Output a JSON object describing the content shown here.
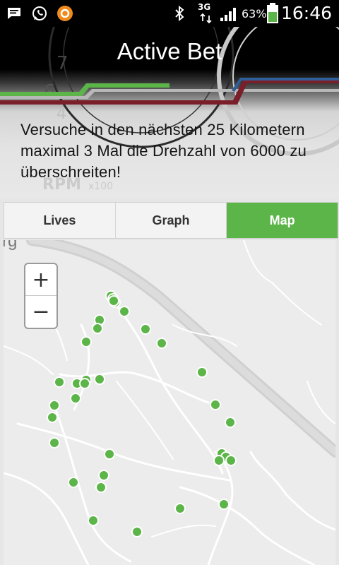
{
  "status": {
    "battery_pct": "63%",
    "network": "3G",
    "time": "16:46"
  },
  "app": {
    "title": "Active Bet"
  },
  "bet": {
    "description": "Versuche in den nächsten 25 Kilometern maximal 3 Mal die Drehzahl von 6000 zu überschreiten!"
  },
  "tabs": [
    {
      "label": "Lives",
      "active": false
    },
    {
      "label": "Graph",
      "active": false
    },
    {
      "label": "Map",
      "active": true
    }
  ],
  "map": {
    "zoom_in": "+",
    "zoom_out": "−",
    "corner_label": "rg",
    "marker_color": "#5cb548",
    "accent_color": "#5cb548"
  }
}
